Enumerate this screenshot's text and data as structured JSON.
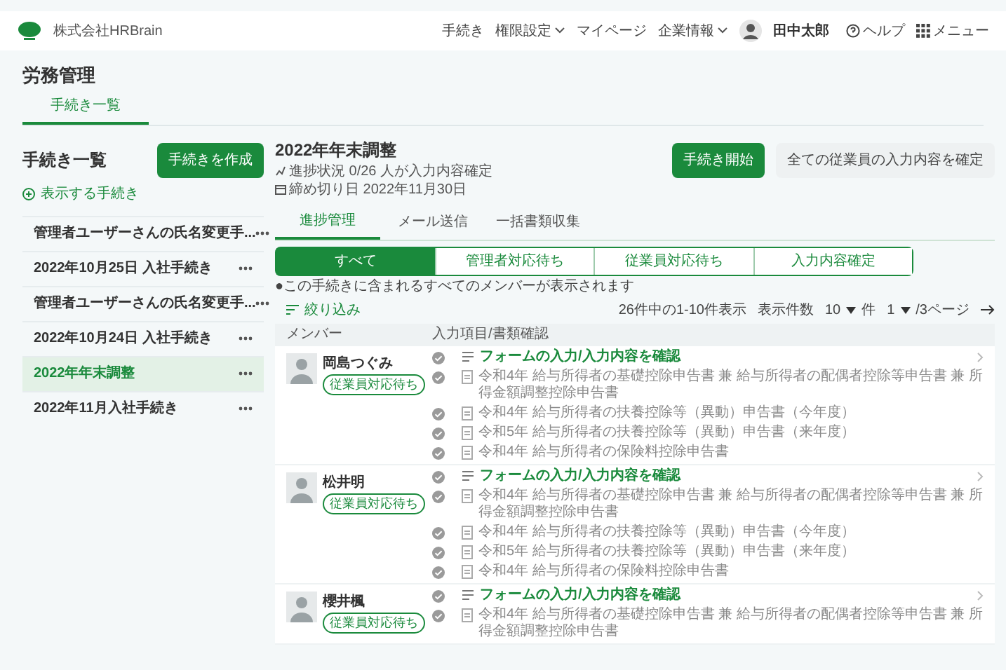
{
  "header": {
    "company": "株式会社HRBrain",
    "nav": [
      {
        "label": "手続き",
        "dropdown": false
      },
      {
        "label": "権限設定",
        "dropdown": true
      },
      {
        "label": "マイページ",
        "dropdown": false
      },
      {
        "label": "企業情報",
        "dropdown": true
      }
    ],
    "user": "田中太郎",
    "help": "ヘルプ",
    "menu": "メニュー"
  },
  "page_title": "労務管理",
  "page_tabs": [
    {
      "label": "手続き一覧",
      "selected": true
    }
  ],
  "sidebar": {
    "title": "手続き一覧",
    "create_button": "手続きを作成",
    "filter_link": "表示する手続き",
    "items": [
      {
        "label": "管理者ユーザーさんの氏名変更手...",
        "selected": false
      },
      {
        "label": "2022年10月25日 入社手続き",
        "selected": false
      },
      {
        "label": "管理者ユーザーさんの氏名変更手...",
        "selected": false
      },
      {
        "label": "2022年10月24日 入社手続き",
        "selected": false
      },
      {
        "label": "2022年年末調整",
        "selected": true
      },
      {
        "label": "2022年11月入社手続き",
        "selected": false
      }
    ]
  },
  "main": {
    "title": "2022年年末調整",
    "progress": "進捗状況 0/26 人が入力内容確定",
    "deadline": "締め切り日 2022年11月30日",
    "buttons": [
      {
        "label": "手続き開始",
        "kind": "primary"
      },
      {
        "label": "全ての従業員の入力内容を確定",
        "kind": "secondary"
      }
    ],
    "tabs": [
      {
        "label": "進捗管理",
        "selected": true
      },
      {
        "label": "メール送信",
        "selected": false
      },
      {
        "label": "一括書類収集",
        "selected": false
      }
    ],
    "segments": [
      {
        "label": "すべて",
        "selected": true
      },
      {
        "label": "管理者対応待ち",
        "selected": false
      },
      {
        "label": "従業員対応待ち",
        "selected": false
      },
      {
        "label": "入力内容確定",
        "selected": false
      }
    ],
    "note": "●この手続きに含まれるすべてのメンバーが表示されます",
    "filter": "絞り込み",
    "pagination": {
      "summary": "26件中の1-10件表示",
      "per_page_label": "表示件数",
      "per_page": "10",
      "per_page_unit": "件",
      "page": "1",
      "page_total": "/3ページ"
    },
    "columns": [
      "メンバー",
      "入力項目/書類確認"
    ],
    "members": [
      {
        "name": "岡島つぐみ",
        "status": "従業員対応待ち",
        "items": [
          {
            "kind": "form",
            "text": "フォームの入力/入力内容を確認"
          },
          {
            "kind": "document",
            "text": "令和4年 給与所得者の基礎控除申告書 兼 給与所得者の配偶者控除等申告書 兼 所得金額調整控除申告書"
          },
          {
            "kind": "document",
            "text": "令和4年 給与所得者の扶養控除等（異動）申告書（今年度）"
          },
          {
            "kind": "document",
            "text": "令和5年 給与所得者の扶養控除等（異動）申告書（来年度）"
          },
          {
            "kind": "document",
            "text": "令和4年 給与所得者の保険料控除申告書"
          }
        ]
      },
      {
        "name": "松井明",
        "status": "従業員対応待ち",
        "items": [
          {
            "kind": "form",
            "text": "フォームの入力/入力内容を確認"
          },
          {
            "kind": "document",
            "text": "令和4年 給与所得者の基礎控除申告書 兼 給与所得者の配偶者控除等申告書 兼 所得金額調整控除申告書"
          },
          {
            "kind": "document",
            "text": "令和4年 給与所得者の扶養控除等（異動）申告書（今年度）"
          },
          {
            "kind": "document",
            "text": "令和5年 給与所得者の扶養控除等（異動）申告書（来年度）"
          },
          {
            "kind": "document",
            "text": "令和4年 給与所得者の保険料控除申告書"
          }
        ]
      },
      {
        "name": "櫻井楓",
        "status": "従業員対応待ち",
        "items": [
          {
            "kind": "form",
            "text": "フォームの入力/入力内容を確認"
          },
          {
            "kind": "document",
            "text": "令和4年 給与所得者の基礎控除申告書 兼 給与所得者の配偶者控除等申告書 兼 所得金額調整控除申告書"
          }
        ]
      }
    ]
  }
}
